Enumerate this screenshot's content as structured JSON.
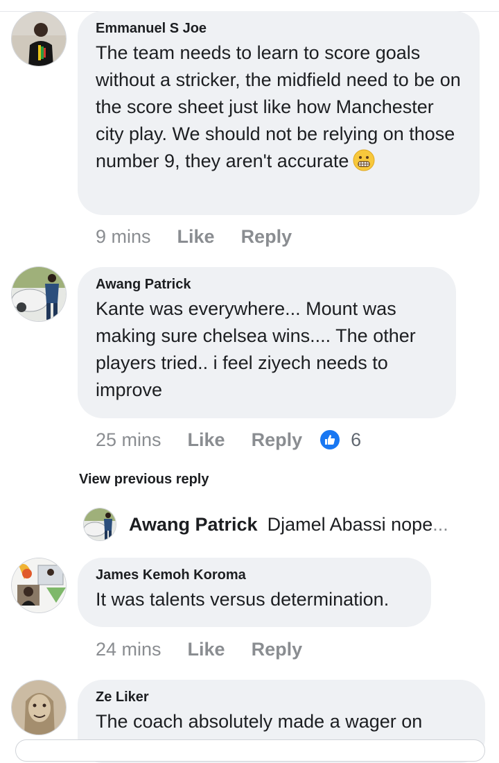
{
  "comments": [
    {
      "author": "Emmanuel S Joe",
      "text": "The team needs to learn to score goals without a stricker, the midfield need to be on the score sheet just like how Manchester city play. We should not be relying on those number 9, they aren't accurate",
      "emoji": "grimacing-face",
      "time": "9 mins",
      "like": "Like",
      "reply": "Reply"
    },
    {
      "author": "Awang Patrick",
      "text": "Kante was everywhere... Mount was making sure chelsea wins.... The other players tried.. i feel ziyech needs to improve",
      "time": "25 mins",
      "like": "Like",
      "reply": "Reply",
      "reaction_icon": "thumbs-up-icon",
      "reaction_count": "6"
    },
    {
      "author": "James Kemoh Koroma",
      "text": "It was talents versus determination.",
      "time": "24 mins",
      "like": "Like",
      "reply": "Reply"
    },
    {
      "author": "Ze Liker",
      "text": "The coach absolutely made a wager on"
    }
  ],
  "view_previous_reply": "View previous reply",
  "reply_preview": {
    "author": "Awang Patrick",
    "text": "Djamel Abassi nope",
    "ellipsis": "..."
  },
  "colors": {
    "bubble": "#eff1f4",
    "meta": "#8a8d91",
    "like_blue": "#1877f2"
  }
}
